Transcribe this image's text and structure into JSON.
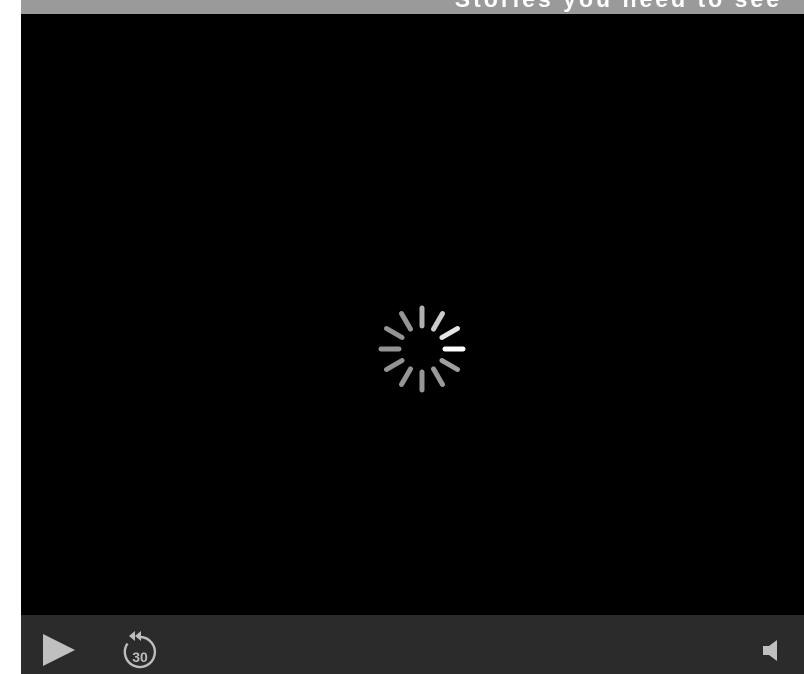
{
  "title_bar": {
    "partial_title": "Stories you need to see"
  },
  "video": {
    "state": "loading",
    "spinner_icon": "loading-spinner-icon"
  },
  "controls": {
    "play_icon": "play-icon",
    "skip_back_icon": "rewind-30-icon",
    "skip_back_label": "30",
    "volume_icon": "volume-icon"
  },
  "colors": {
    "title_bar_bg": "#9a9a9a",
    "video_bg": "#000000",
    "control_bar_bg": "#2b2b2b",
    "icon_color": "#c0c0c0"
  }
}
